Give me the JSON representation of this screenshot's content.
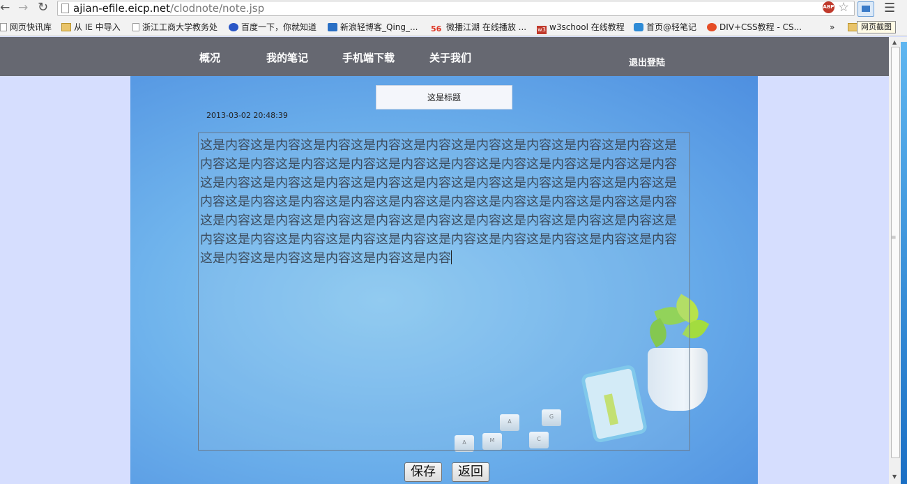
{
  "browser": {
    "url_host": "ajian-efile.eicp.net",
    "url_path": "/clodnote/note.jsp",
    "abp_label": "ABP",
    "screenshot_tooltip": "网页截图",
    "bookmarks": [
      {
        "label": "网页快讯库",
        "icon": "page-icon"
      },
      {
        "label": "从 IE 中导入",
        "icon": "folder-icon"
      },
      {
        "label": "浙江工商大学教务处",
        "icon": "page-icon"
      },
      {
        "label": "百度一下，你就知道",
        "icon": "paw-icon"
      },
      {
        "label": "新浪轻博客_Qing_...",
        "icon": "blog-icon"
      },
      {
        "label": "微播江湖 在线播放 ...",
        "icon": "56-icon"
      },
      {
        "label": "w3school 在线教程",
        "icon": "w3-icon"
      },
      {
        "label": "首页@轻笔记",
        "icon": "cloud-icon"
      },
      {
        "label": "DIV+CSS教程 - CS...",
        "icon": "css5-icon"
      }
    ],
    "bookmarks_overflow": "»",
    "fifty_six": "56",
    "w3": "w3"
  },
  "sitenav": {
    "items": [
      "概况",
      "我的笔记",
      "手机端下载",
      "关于我们"
    ],
    "logout": "退出登陆"
  },
  "note": {
    "title": "这是标题",
    "timestamp": "2013-03-02 20:48:39",
    "content": "这是内容这是内容这是内容这是内容这是内容这是内容这是内容这是内容这是内容这是内容这是内容这是内容这是内容这是内容这是内容这是内容这是内容这是内容这是内容这是内容这是内容这是内容这是内容这是内容这是内容这是内容这是内容这是内容这是内容这是内容这是内容这是内容这是内容这是内容这是内容这是内容这是内容这是内容这是内容这是内容这是内容这是内容这是内容这是内容这是内容这是内容这是内容这是内容这是内容这是内容这是内容这是内容这是内容这是内容这是内容这是内容这是内容这是内容这是内容这是内容这是内容这是内容"
  },
  "actions": {
    "save": "保存",
    "back": "返回"
  },
  "keys": [
    "A",
    "M",
    "C",
    "A",
    "G"
  ]
}
